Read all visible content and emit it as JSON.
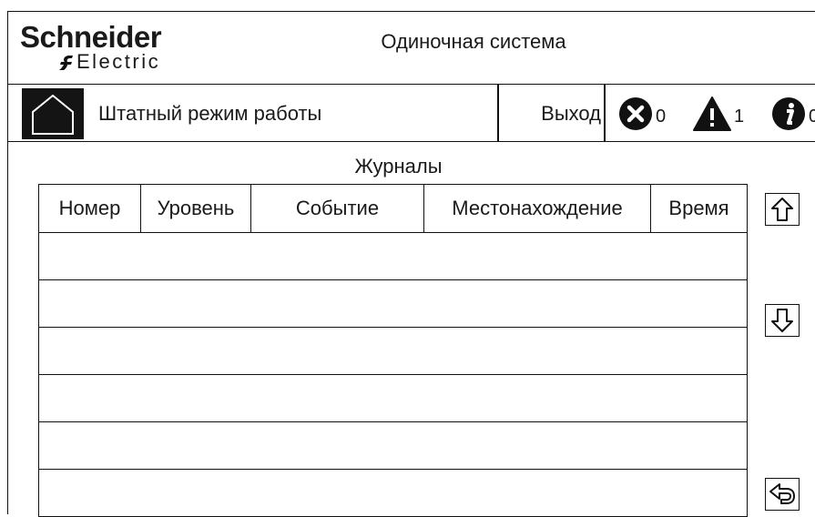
{
  "brand": {
    "name": "Schneider",
    "sub": "Electric"
  },
  "header": {
    "title": "Одиночная система"
  },
  "status_bar": {
    "mode_label": "Штатный режим работы",
    "exit_label": "Выход",
    "alarms": {
      "errors": "0",
      "warnings": "1",
      "info": "0"
    }
  },
  "journal": {
    "title": "Журналы",
    "columns": [
      "Номер",
      "Уровень",
      "Событие",
      "Местонахождение",
      "Время"
    ],
    "rows": [
      [
        "",
        "",
        "",
        "",
        ""
      ],
      [
        "",
        "",
        "",
        "",
        ""
      ],
      [
        "",
        "",
        "",
        "",
        ""
      ],
      [
        "",
        "",
        "",
        "",
        ""
      ],
      [
        "",
        "",
        "",
        "",
        ""
      ],
      [
        "",
        "",
        "",
        "",
        ""
      ]
    ]
  },
  "icons": {
    "home": "home-icon",
    "error": "error-x-icon",
    "warning": "warning-icon",
    "info": "info-icon",
    "scroll_up": "arrow-up-icon",
    "scroll_down": "arrow-down-icon",
    "back": "back-arrow-icon"
  }
}
